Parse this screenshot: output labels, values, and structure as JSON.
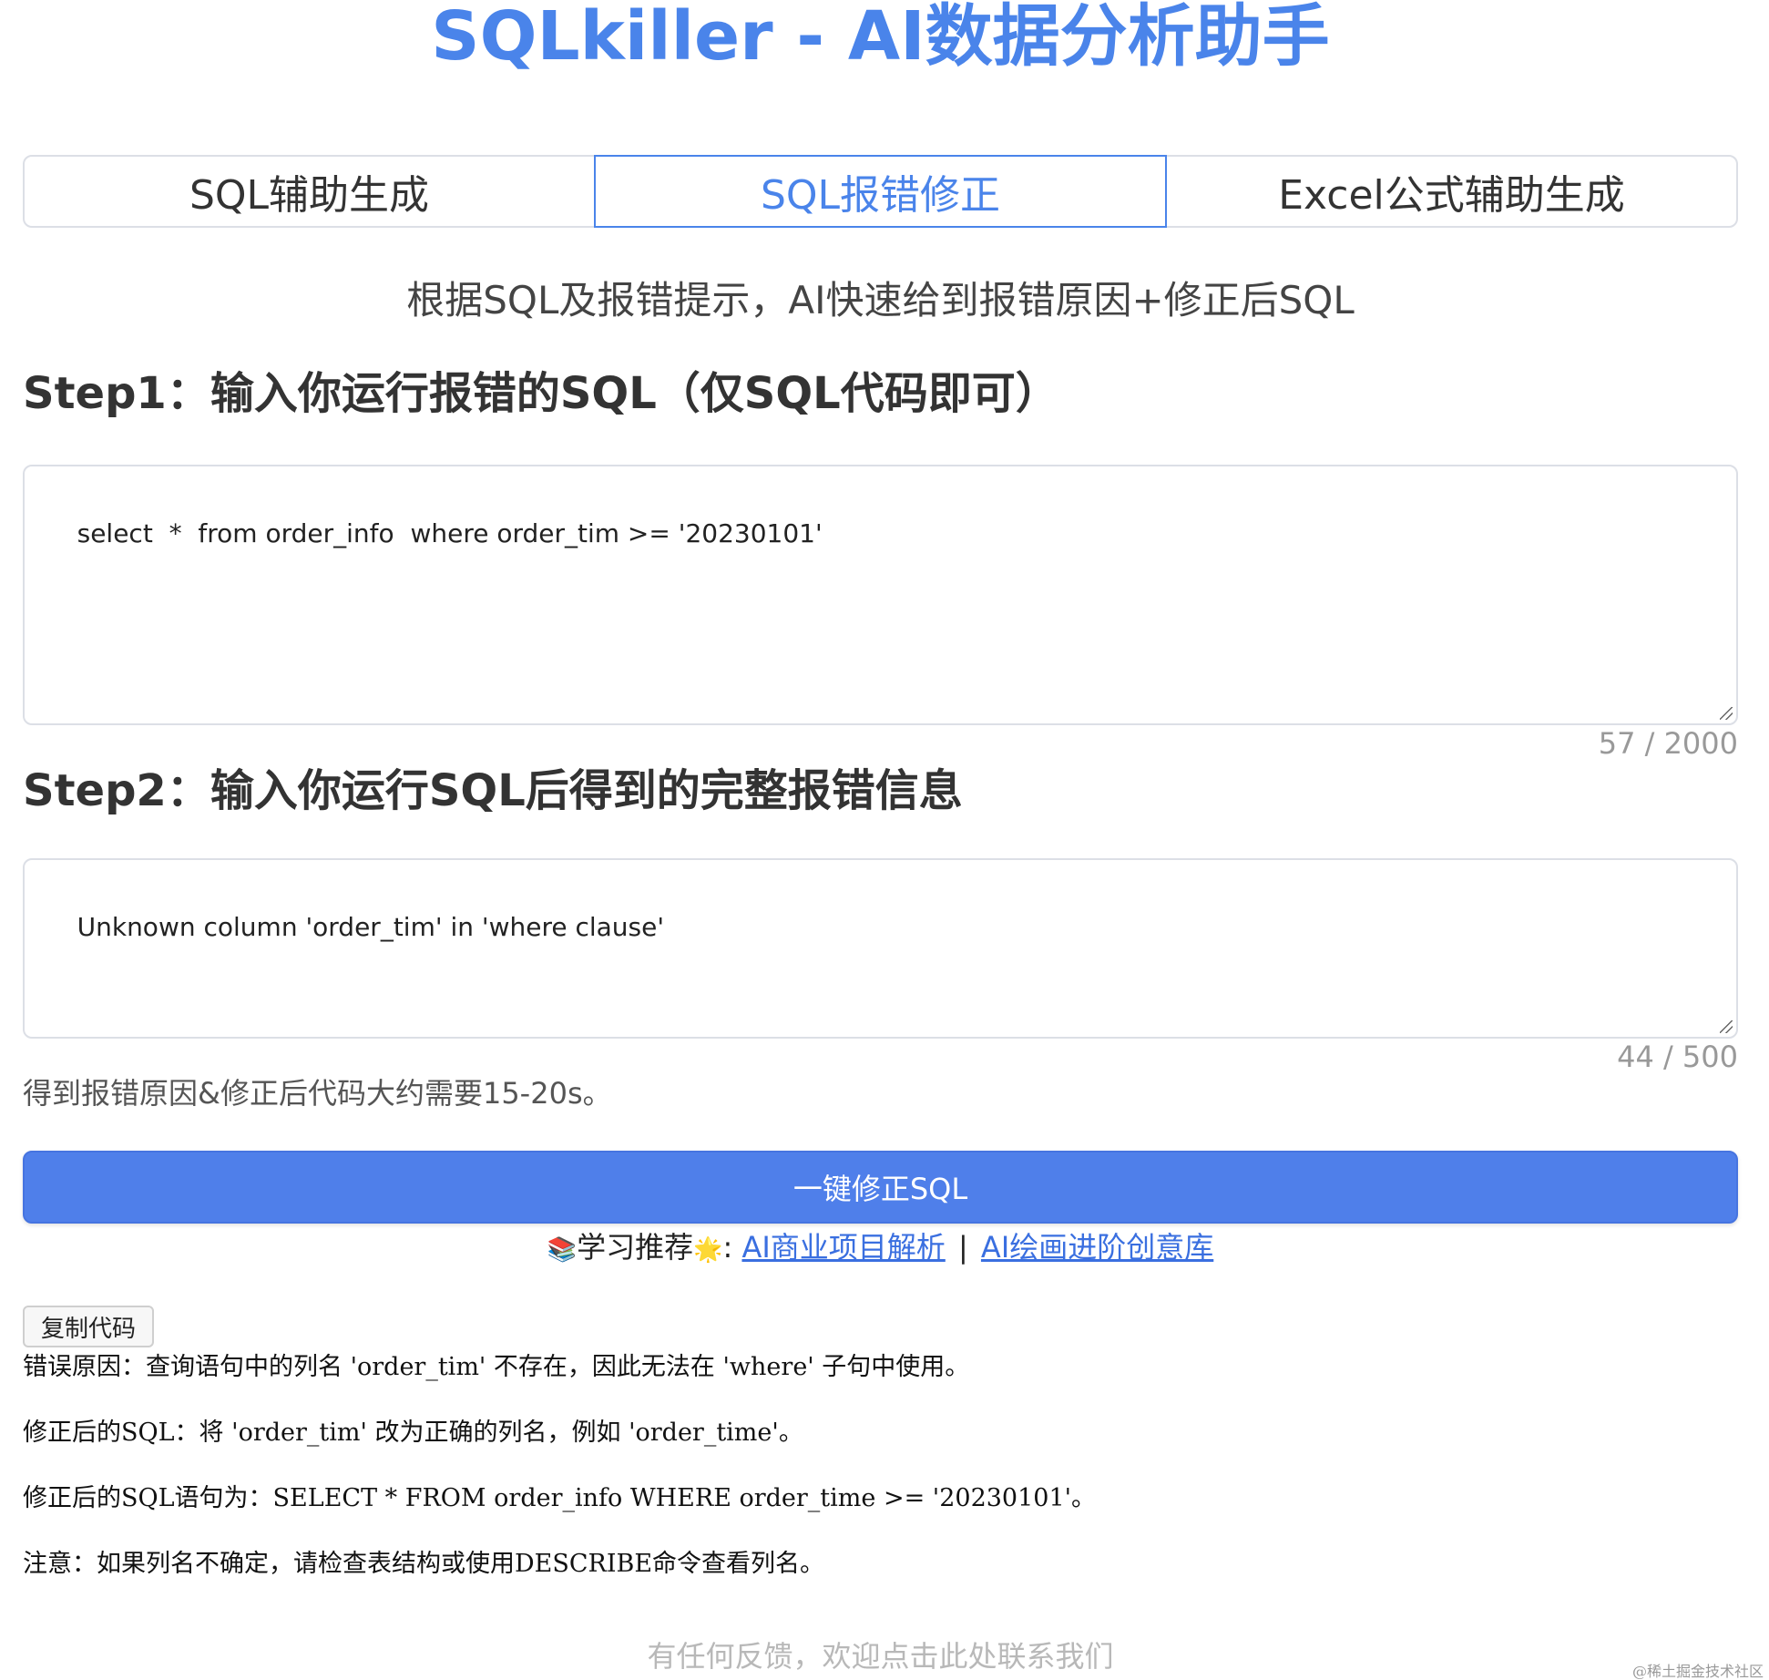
{
  "header": {
    "title": "SQLkiller - AI数据分析助手"
  },
  "tabs": [
    {
      "label": "SQL辅助生成",
      "active": false
    },
    {
      "label": "SQL报错修正",
      "active": true
    },
    {
      "label": "Excel公式辅助生成",
      "active": false
    }
  ],
  "subtitle": "根据SQL及报错提示，AI快速给到报错原因+修正后SQL",
  "step1": {
    "heading": "Step1：输入你运行报错的SQL（仅SQL代码即可）",
    "value": "select  *  from order_info  where order_tim >= '20230101'",
    "counter": "57 / 2000"
  },
  "step2": {
    "heading": "Step2：输入你运行SQL后得到的完整报错信息",
    "value": "Unknown column 'order_tim' in 'where clause'",
    "counter": "44 / 500"
  },
  "hint": "得到报错原因&修正后代码大约需要15-20s。",
  "fix_button": "一键修正SQL",
  "learn": {
    "books_emoji": "📚",
    "label": "学习推荐",
    "star_emoji": "🌟",
    "colon": ":",
    "link1": "AI商业项目解析",
    "separator": "|",
    "link2": "AI绘画进阶创意库"
  },
  "copy_button": "复制代码",
  "result": {
    "line1": "错误原因：查询语句中的列名 'order_tim' 不存在，因此无法在 'where' 子句中使用。",
    "line2": "修正后的SQL：将 'order_tim' 改为正确的列名，例如 'order_time'。",
    "line3": "修正后的SQL语句为：SELECT * FROM order_info WHERE order_time >= '20230101'。",
    "line4": "注意：如果列名不确定，请检查表结构或使用DESCRIBE命令查看列名。"
  },
  "footer": "有任何反馈，欢迎点击此处联系我们",
  "watermark": "@稀土掘金技术社区",
  "colors": {
    "accent": "#4a84ea",
    "button_bg": "#4f7fea",
    "border": "#dcdfe6",
    "muted": "#999999"
  },
  "icons": {
    "resize_grip": "resize-grip-icon",
    "books": "books-emoji-icon",
    "star": "glowing-star-emoji-icon"
  }
}
